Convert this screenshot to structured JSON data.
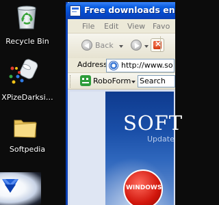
{
  "desktop": {
    "icons": [
      {
        "label": "Recycle Bin",
        "icon": "recycle-bin-icon"
      },
      {
        "label": "XPizeDarksi…",
        "icon": "xpize-icon"
      },
      {
        "label": "Softpedia",
        "icon": "folder-icon"
      }
    ]
  },
  "browser": {
    "title": "Free downloads en",
    "menu": [
      "File",
      "Edit",
      "View",
      "Favo"
    ],
    "toolbar": {
      "back_label": "Back"
    },
    "address": {
      "label": "Address",
      "url": "http://www.so"
    },
    "roboform": {
      "label": "RoboForm",
      "search_label": "Search"
    },
    "content": {
      "banner_title": "SOFT",
      "banner_subtitle": "Update",
      "badge": "WINDOWS"
    }
  },
  "colors": {
    "titlebar": "#0a5de0",
    "banner": "#1a4fa8",
    "badge": "#d1160c"
  }
}
